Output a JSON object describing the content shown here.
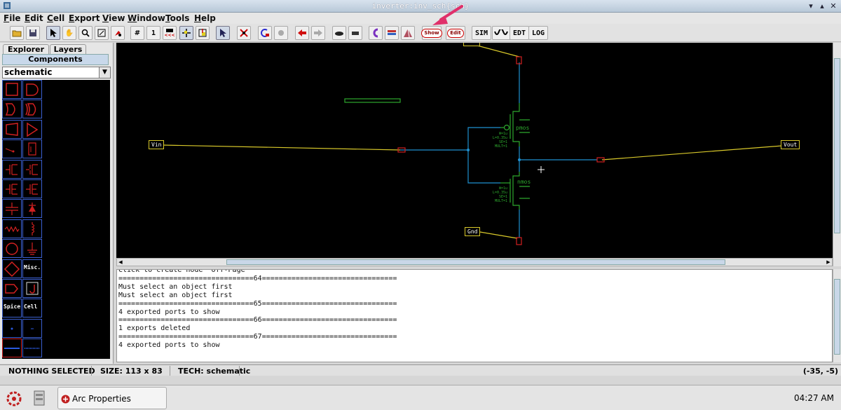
{
  "window": {
    "title": "inverter:inv_sch{sch}"
  },
  "menu": [
    {
      "key": "F",
      "rest": "ile"
    },
    {
      "key": "E",
      "rest": "dit"
    },
    {
      "key": "C",
      "rest": "ell"
    },
    {
      "key": "E",
      "rest": "xport"
    },
    {
      "key": "V",
      "rest": "iew"
    },
    {
      "key": "W",
      "rest": "indow"
    },
    {
      "key": "T",
      "rest": "ools"
    },
    {
      "key": "H",
      "rest": "elp"
    }
  ],
  "toolbar": {
    "grid_count": "1",
    "grid_hint": "<<<",
    "show_label": "Show",
    "edit_label": "Edit",
    "sim_label": "SIM",
    "edt_label": "EDT",
    "log_label": "LOG"
  },
  "sidebar": {
    "tabs": [
      "Explorer",
      "Layers"
    ],
    "components_label": "Components",
    "technology": "schematic",
    "palette_labels": {
      "misc": "Misc.",
      "spice": "Spice",
      "cell": "Cell"
    }
  },
  "schematic": {
    "exports": {
      "vin": "Vin",
      "vout": "Vout",
      "gnd": "Gnd"
    },
    "transistors": {
      "pmos": {
        "name": "pmos",
        "params": [
          "W=1u",
          "L=0.35u",
          "SE=1",
          "MULT=1"
        ]
      },
      "nmos": {
        "name": "nmos",
        "params": [
          "W=1u",
          "L=0.35u",
          "SE=1",
          "MULT=1"
        ]
      }
    }
  },
  "console": {
    "lines": [
      "Click to create node 'Off-Page'",
      "================================64================================",
      "Must select an object first",
      "Must select an object first",
      "================================65================================",
      "4 exported ports to show",
      "================================66================================",
      "1 exports deleted",
      "================================67================================",
      "4 exported ports to show"
    ]
  },
  "status": {
    "selection": "NOTHING SELECTED",
    "size": "SIZE: 113 x 83",
    "tech": "TECH: schematic",
    "coords": "(-35, -5)"
  },
  "taskbar": {
    "task_label": "Arc Properties",
    "clock": "04:27 AM"
  },
  "colors": {
    "canvas": "#000000",
    "wire": "#1f8fcf",
    "export_wire": "#d8c82a",
    "transistor": "#2da82d",
    "pin": "#d02020",
    "palette_border": "#3a5fcf"
  }
}
